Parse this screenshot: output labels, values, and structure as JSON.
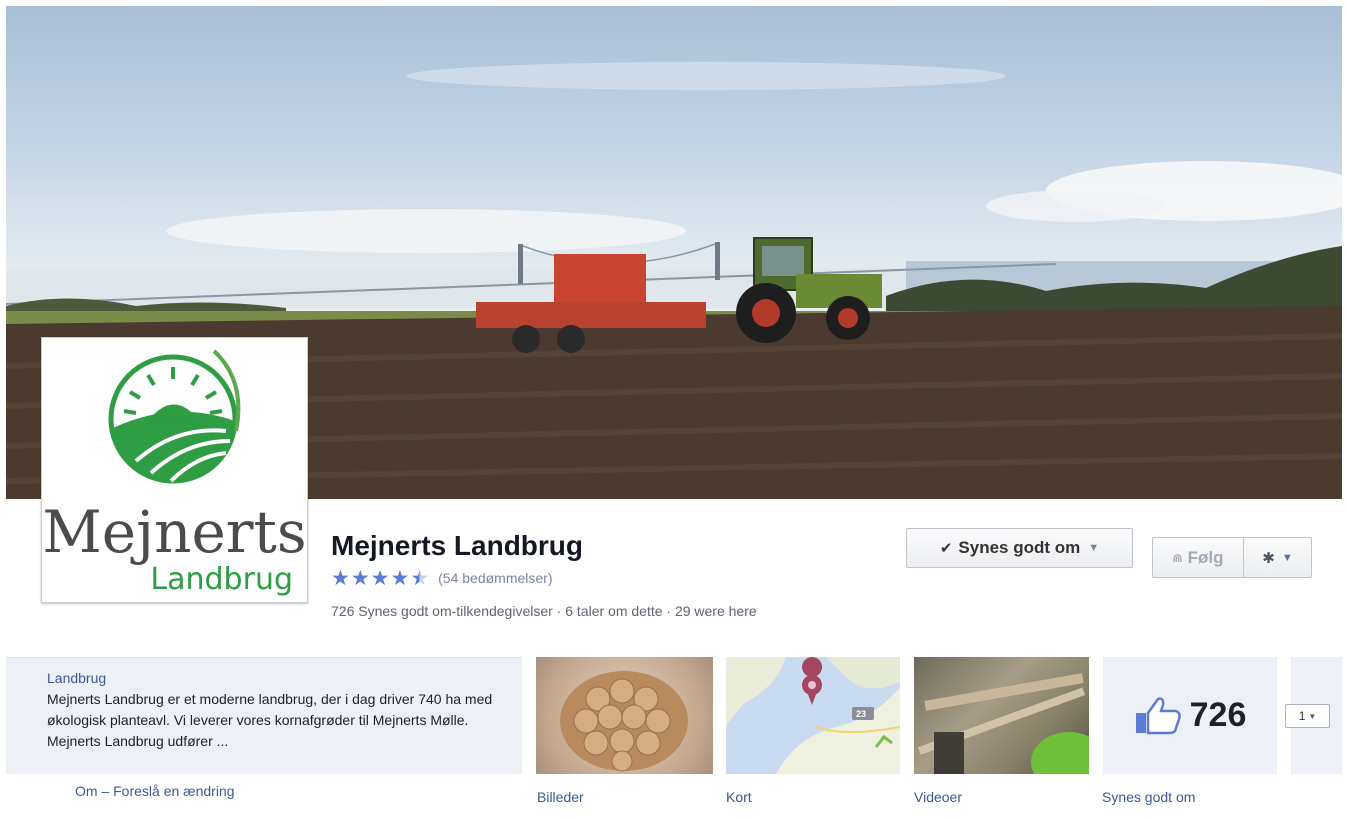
{
  "cover": {
    "alt": "Tractor with seeder on a ploughed field, bridge and sea in background"
  },
  "profile": {
    "logo_line1": "Mejnerts",
    "logo_line2": "Landbrug"
  },
  "page": {
    "name": "Mejnerts Landbrug",
    "rating_stars": 4.5,
    "rating_count": "(54 bedømmelser)",
    "stats": "726 Synes godt om-tilkendegivelser · 6 taler om dette · 29 were here"
  },
  "actions": {
    "like_label": "Synes godt om",
    "follow_label": "Følg"
  },
  "about": {
    "category": "Landbrug",
    "text": "Mejnerts Landbrug er et moderne landbrug, der i dag driver 740 ha med økologisk planteavl. Vi leverer vores kornafgrøder til Mejnerts Mølle. Mejnerts Landbrug udfører ...",
    "links": "Om – Foreslå en ændring"
  },
  "tiles": {
    "photos_label": "Billeder",
    "map_label": "Kort",
    "map_badge": "23",
    "videos_label": "Videoer",
    "likes_label": "Synes godt om",
    "likes_count": "726"
  },
  "pager": {
    "selected": "1"
  },
  "colors": {
    "link_blue": "#3b5998",
    "star_blue": "#5b7bd5",
    "logo_green": "#2e9d43",
    "panel_bg": "#edf0f6"
  },
  "icons": [
    "check-icon",
    "chevron-down-icon",
    "rss-icon",
    "gear-icon",
    "thumbs-up-icon",
    "map-pin-icon"
  ]
}
